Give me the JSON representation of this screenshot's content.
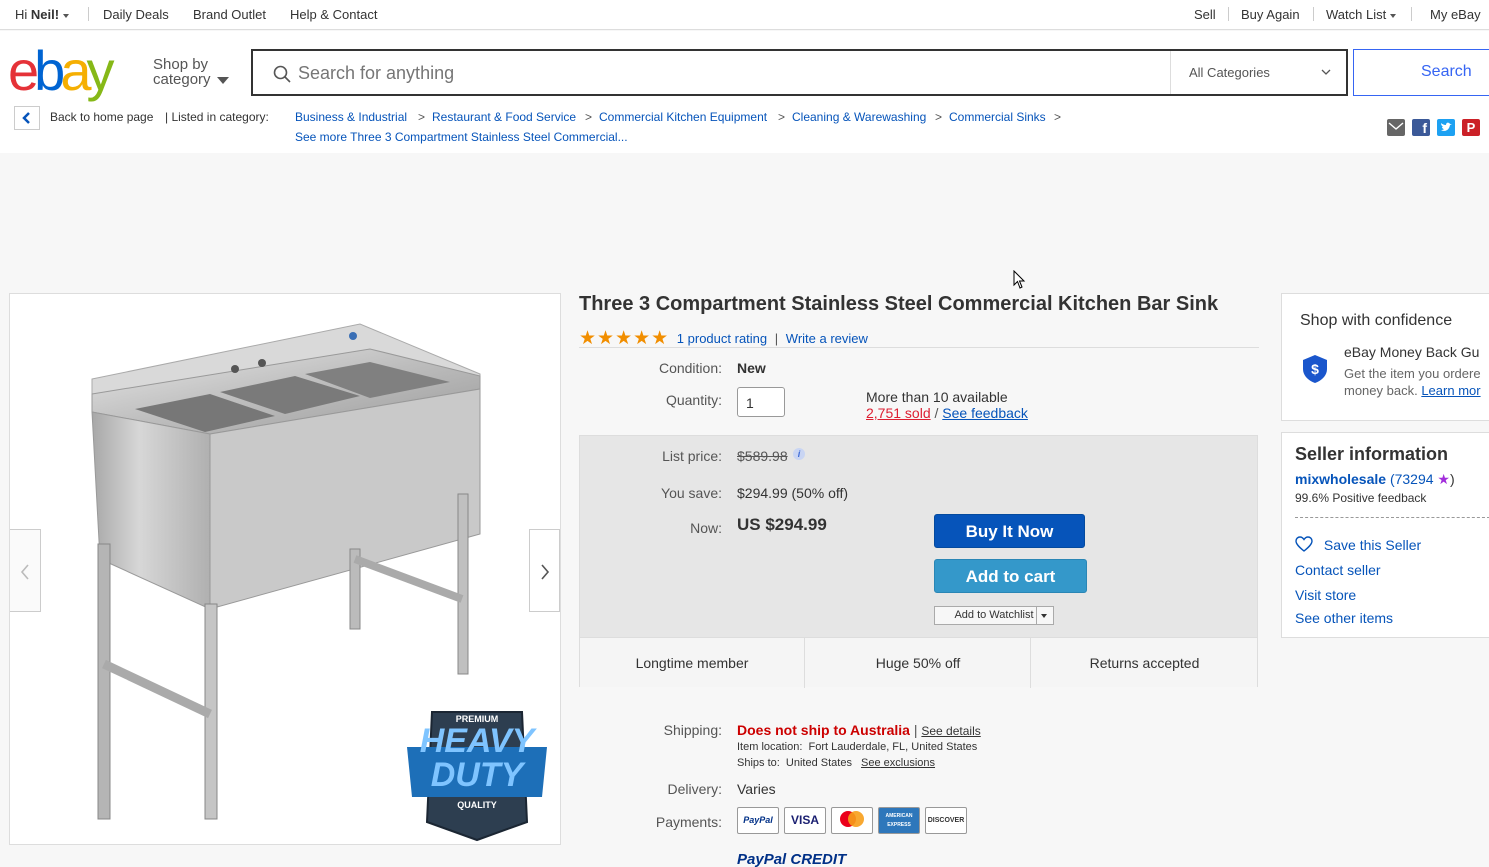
{
  "topbar": {
    "greeting_prefix": "Hi ",
    "greeting_name": "Neil!",
    "daily_deals": "Daily Deals",
    "brand_outlet": "Brand Outlet",
    "help_contact": "Help & Contact",
    "sell": "Sell",
    "buy_again": "Buy Again",
    "watch_list": "Watch List",
    "my_ebay": "My eBay"
  },
  "header": {
    "logo_letters": [
      "e",
      "b",
      "a",
      "y"
    ],
    "shop_by_line1": "Shop by",
    "shop_by_line2": "category",
    "search_placeholder": "Search for anything",
    "category_select": "All Categories",
    "search_button": "Search"
  },
  "breadcrumb": {
    "back_label": "Back to home page",
    "listed_in": "| Listed in category:",
    "items": [
      "Business & Industrial",
      "Restaurant & Food Service",
      "Commercial Kitchen Equipment",
      "Cleaning & Warewashing",
      "Commercial Sinks"
    ],
    "separator": ">",
    "see_more": "See more Three 3 Compartment Stainless Steel Commercial..."
  },
  "gallery": {
    "badge_top": "PREMIUM",
    "badge_main1": "HEAVY",
    "badge_main2": "DUTY",
    "badge_bottom": "QUALITY"
  },
  "product": {
    "title": "Three 3 Compartment Stainless Steel Commercial Kitchen Bar Sink",
    "stars": 5,
    "rating_text": "1 product rating",
    "rating_sep": "|",
    "write_review": "Write a review",
    "condition_label": "Condition:",
    "condition_value": "New",
    "quantity_label": "Quantity:",
    "quantity_value": "1",
    "availability": "More than 10 available",
    "sold": "2,751 sold",
    "slash": "/",
    "see_feedback": "See feedback"
  },
  "pricing": {
    "list_price_label": "List price:",
    "list_price": "$589.98",
    "you_save_label": "You save:",
    "you_save": "$294.99 (50% off)",
    "now_label": "Now:",
    "now_price": "US $294.99",
    "buy_now": "Buy It Now",
    "add_to_cart": "Add to cart",
    "add_to_watchlist": "Add to Watchlist",
    "highlights": [
      "Longtime member",
      "Huge 50% off",
      "Returns accepted"
    ],
    "colors": {
      "buy_now": "#0654ba",
      "add_to_cart": "#3498ca"
    }
  },
  "shipping": {
    "shipping_label": "Shipping:",
    "shipping_value": "Does not ship to Australia",
    "bar": "|",
    "see_details": "See details",
    "item_location": "Item location:  Fort Lauderdale, FL, United States",
    "ships_to": "Ships to:  United States",
    "see_exclusions": "See exclusions",
    "delivery_label": "Delivery:",
    "delivery_value": "Varies",
    "payments_label": "Payments:",
    "payment_methods": [
      "PayPal",
      "VISA",
      "mastercard",
      "AMERICAN EXPRESS",
      "DISCOVER"
    ],
    "paypal_credit": "PayPal CREDIT"
  },
  "confidence": {
    "heading": "Shop with confidence",
    "guarantee_title": "eBay Money Back Gu",
    "guarantee_text1": "Get the item you ordere",
    "guarantee_text2": "money back.",
    "learn_more": "Learn mor"
  },
  "seller": {
    "heading": "Seller information",
    "name": "mixwholesale",
    "feedback_count": "(73294",
    "feedback_close": ")",
    "positive": "99.6% Positive feedback",
    "save_seller": "Save this Seller",
    "contact": "Contact seller",
    "visit_store": "Visit store",
    "other_items": "See other items"
  },
  "share_icons": [
    "email-icon",
    "facebook-icon",
    "twitter-icon",
    "pinterest-icon"
  ]
}
